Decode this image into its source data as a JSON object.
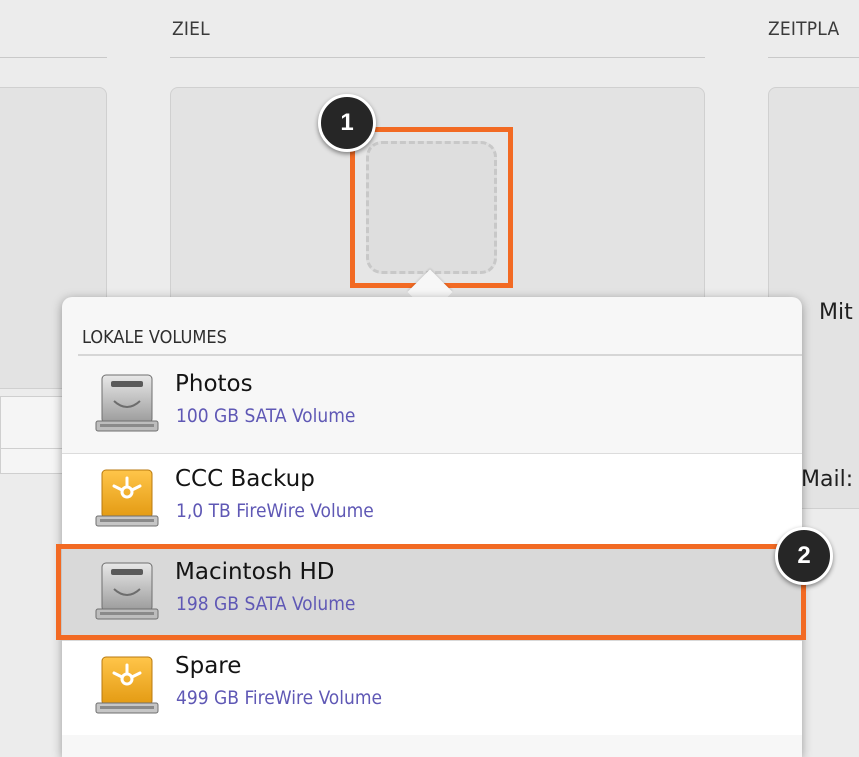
{
  "columns": {
    "ziel_title": "ZIEL",
    "zeitplan_title": "ZEITPLA"
  },
  "right_labels": {
    "mit": "Mit",
    "mail": "Mail:"
  },
  "badges": {
    "one": "1",
    "two": "2"
  },
  "popover": {
    "section_title": "LOKALE VOLUMES",
    "volumes": [
      {
        "name": "Photos",
        "detail": "100 GB SATA Volume",
        "icon": "internal-drive-icon",
        "state": "normal"
      },
      {
        "name": "CCC Backup",
        "detail": "1,0 TB FireWire Volume",
        "icon": "firewire-drive-icon",
        "state": "normal"
      },
      {
        "name": "Macintosh HD",
        "detail": "198 GB SATA Volume",
        "icon": "internal-drive-icon",
        "state": "selected"
      },
      {
        "name": "Spare",
        "detail": "499 GB FireWire Volume",
        "icon": "firewire-drive-icon",
        "state": "normal"
      }
    ]
  },
  "colors": {
    "highlight": "#f26a23",
    "detail_text": "#5f58b5",
    "badge": "#262626"
  }
}
